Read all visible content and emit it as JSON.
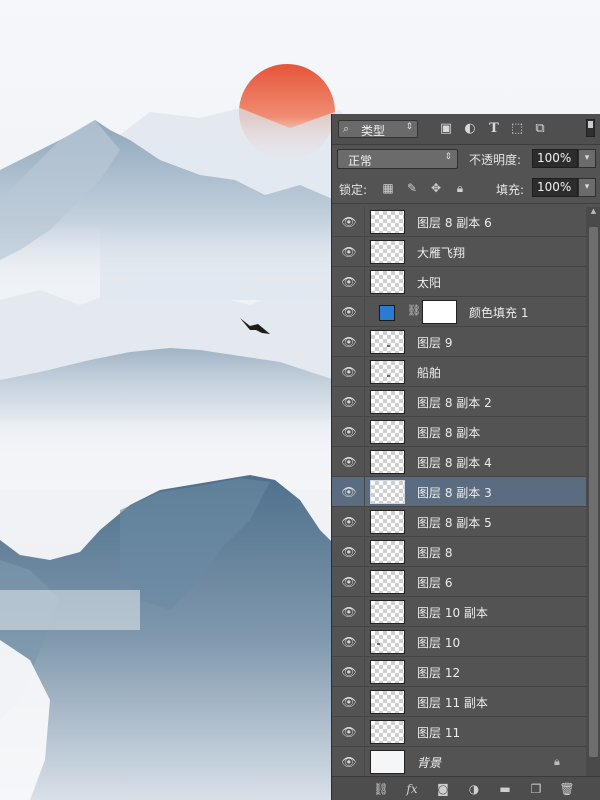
{
  "panel": {
    "filter": {
      "label": "类型"
    },
    "icons": {
      "image": "image-filter-icon",
      "adjust": "adjustment-filter-icon",
      "type": "T",
      "shape": "shape-filter-icon",
      "smart": "smart-object-filter-icon"
    },
    "blend_mode": "正常",
    "opacity_label": "不透明度:",
    "opacity_value": "100%",
    "lock_label": "锁定:",
    "fill_label": "填充:",
    "fill_value": "100%",
    "layers": [
      {
        "name": "图层 8 副本 6",
        "thumb": "transparent"
      },
      {
        "name": "大雁飞翔",
        "thumb": "transparent"
      },
      {
        "name": "太阳",
        "thumb": "transparent"
      },
      {
        "name": "颜色填充 1",
        "thumb": "fill",
        "swatch": "#2b7bd0"
      },
      {
        "name": "图层 9",
        "thumb": "transparent"
      },
      {
        "name": "船舶",
        "thumb": "transparent"
      },
      {
        "name": "图层 8 副本 2",
        "thumb": "transparent"
      },
      {
        "name": "图层 8 副本",
        "thumb": "transparent"
      },
      {
        "name": "图层 8 副本 4",
        "thumb": "transparent"
      },
      {
        "name": "图层 8 副本 3",
        "thumb": "transparent",
        "selected": true
      },
      {
        "name": "图层 8 副本 5",
        "thumb": "transparent"
      },
      {
        "name": "图层 8",
        "thumb": "transparent"
      },
      {
        "name": "图层 6",
        "thumb": "transparent"
      },
      {
        "name": "图层 10 副本",
        "thumb": "transparent"
      },
      {
        "name": "图层 10",
        "thumb": "transparent"
      },
      {
        "name": "图层 12",
        "thumb": "transparent"
      },
      {
        "name": "图层 11 副本",
        "thumb": "transparent"
      },
      {
        "name": "图层 11",
        "thumb": "transparent"
      },
      {
        "name": "背景",
        "thumb": "background",
        "locked": true
      }
    ],
    "bottom_icons": [
      "link-layers-icon",
      "fx-icon",
      "add-mask-icon",
      "new-adjustment-icon",
      "new-group-icon",
      "new-layer-icon",
      "delete-layer-icon"
    ],
    "fx_label": "fx"
  },
  "colors": {
    "panel_bg": "#535353",
    "selected_row": "#5b6b80",
    "sun": "#e8553a",
    "fill_swatch": "#2b7bd0"
  }
}
